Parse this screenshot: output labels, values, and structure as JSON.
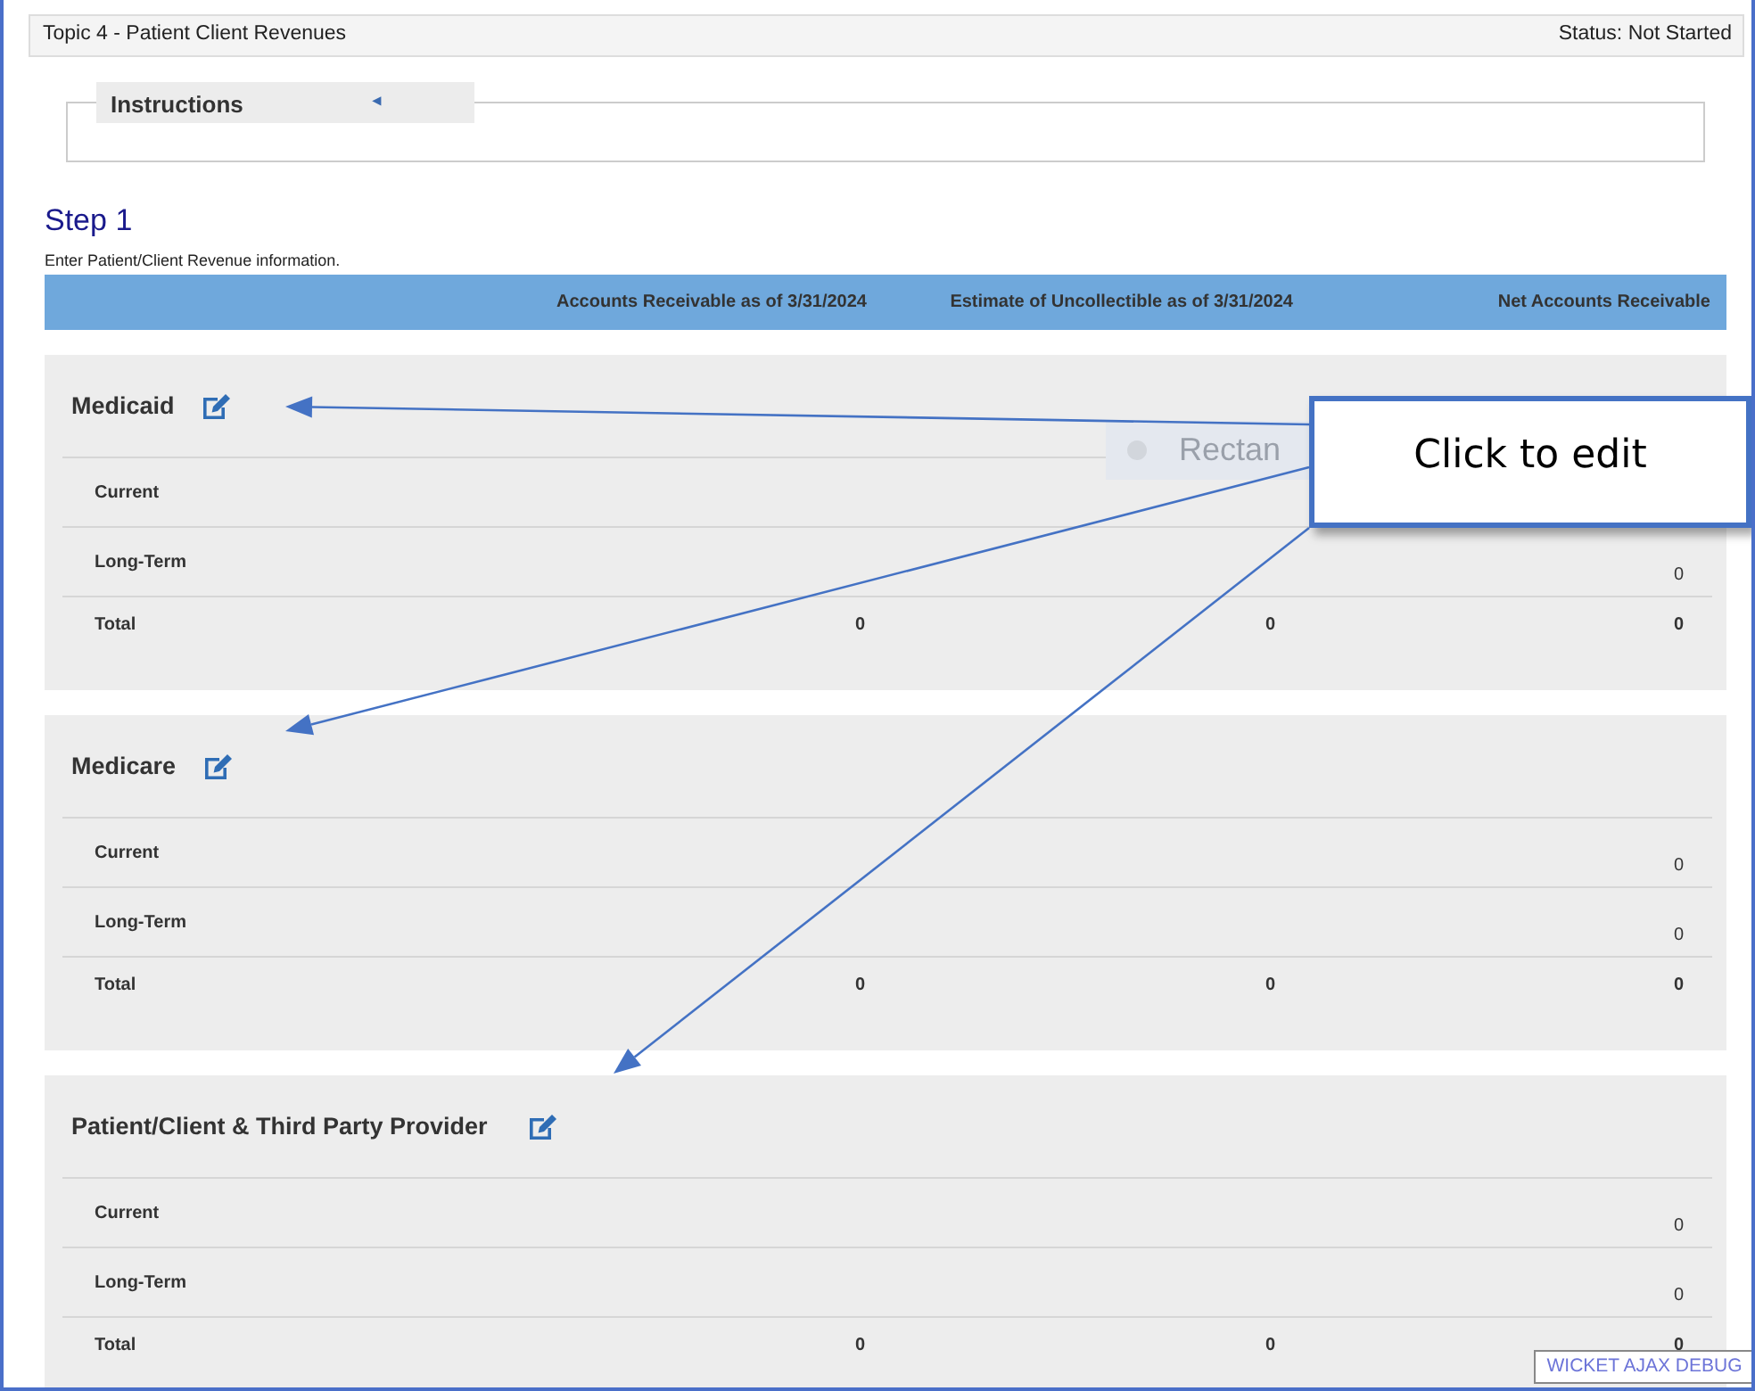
{
  "header": {
    "title": "Topic 4 - Patient Client Revenues",
    "status": "Status: Not Started"
  },
  "instructions": {
    "title": "Instructions",
    "toggle": "◂"
  },
  "step": {
    "title": "Step 1",
    "description": "Enter Patient/Client Revenue information."
  },
  "columns": [
    "Accounts Receivable as of 3/31/2024",
    "Estimate of Uncollectible as of 3/31/2024",
    "Net Accounts Receivable"
  ],
  "sections": [
    {
      "title": "Medicaid",
      "rows": [
        {
          "kind": "line",
          "label": "Current",
          "cells": [
            null,
            null,
            null
          ]
        },
        {
          "kind": "line",
          "label": "Long-Term",
          "cells": [
            null,
            null,
            "0"
          ]
        },
        {
          "kind": "total",
          "label": "Total",
          "cells": [
            "0",
            "0",
            "0"
          ]
        }
      ]
    },
    {
      "title": "Medicare",
      "rows": [
        {
          "kind": "line",
          "label": "Current",
          "cells": [
            null,
            null,
            "0"
          ]
        },
        {
          "kind": "line",
          "label": "Long-Term",
          "cells": [
            null,
            null,
            "0"
          ]
        },
        {
          "kind": "total",
          "label": "Total",
          "cells": [
            "0",
            "0",
            "0"
          ]
        }
      ]
    },
    {
      "title": "Patient/Client & Third Party Provider",
      "rows": [
        {
          "kind": "line",
          "label": "Current",
          "cells": [
            null,
            null,
            "0"
          ]
        },
        {
          "kind": "line",
          "label": "Long-Term",
          "cells": [
            null,
            null,
            "0"
          ]
        },
        {
          "kind": "total",
          "label": "Total",
          "cells": [
            "0",
            "0",
            "0"
          ]
        }
      ]
    }
  ],
  "ghost_tooltip": "Rectan",
  "callout": {
    "text": "Click to edit"
  },
  "debug_button": "WICKET AJAX DEBUG"
}
